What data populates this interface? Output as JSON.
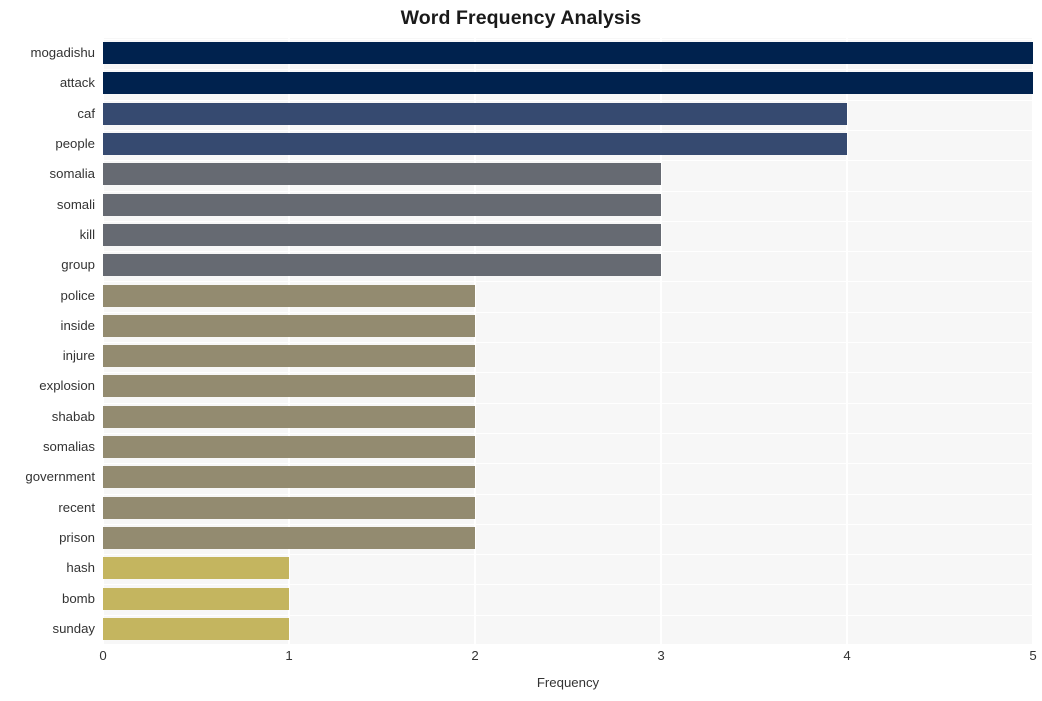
{
  "chart_data": {
    "type": "bar",
    "orientation": "horizontal",
    "title": "Word Frequency Analysis",
    "xlabel": "Frequency",
    "ylabel": "",
    "categories": [
      "mogadishu",
      "attack",
      "caf",
      "people",
      "somalia",
      "somali",
      "kill",
      "group",
      "police",
      "inside",
      "injure",
      "explosion",
      "shabab",
      "somalias",
      "government",
      "recent",
      "prison",
      "hash",
      "bomb",
      "sunday"
    ],
    "values": [
      5,
      5,
      4,
      4,
      3,
      3,
      3,
      3,
      2,
      2,
      2,
      2,
      2,
      2,
      2,
      2,
      2,
      1,
      1,
      1
    ],
    "bar_colors": [
      "#00224e",
      "#00224e",
      "#364a70",
      "#364a70",
      "#666a72",
      "#666a72",
      "#666a72",
      "#666a72",
      "#938b70",
      "#938b70",
      "#938b70",
      "#938b70",
      "#938b70",
      "#938b70",
      "#938b70",
      "#938b70",
      "#938b70",
      "#c4b55f",
      "#c4b55f",
      "#c4b55f"
    ],
    "xlim": [
      0,
      5
    ],
    "xticks": [
      0,
      1,
      2,
      3,
      4,
      5
    ],
    "xtick_labels": [
      "0",
      "1",
      "2",
      "3",
      "4",
      "5"
    ],
    "grid": true,
    "grid_color": "#ffffff",
    "plot_background": "#f7f7f7",
    "figure_background": "#ffffff",
    "legend": null,
    "legend_position": "none"
  }
}
